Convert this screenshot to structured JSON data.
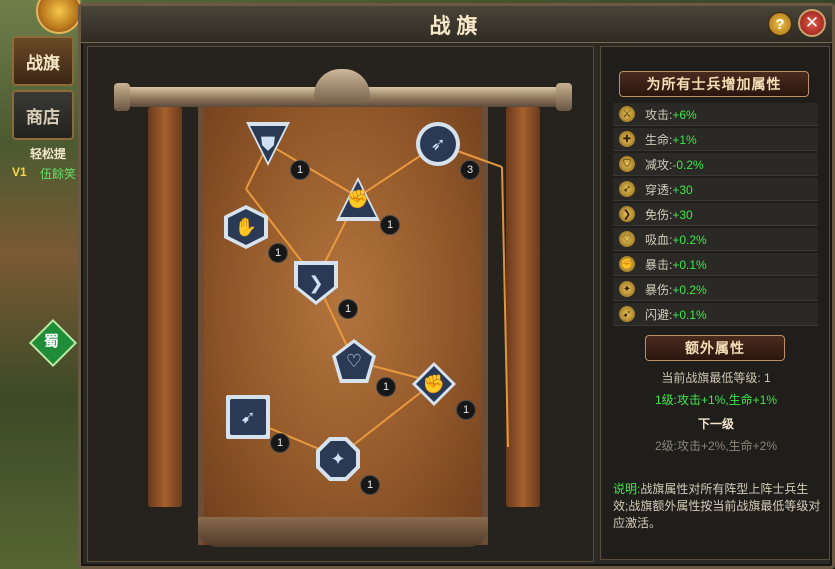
{
  "window": {
    "title": "战旗"
  },
  "sidebar": {
    "tabs": [
      {
        "label": "战旗"
      },
      {
        "label": "商店"
      }
    ]
  },
  "background": {
    "text1": "轻松提",
    "text2": "伍餘笑",
    "text3": "V1",
    "faction": "蜀"
  },
  "flag_nodes": [
    {
      "id": "attack",
      "icon": "triangle-crest-icon",
      "level": "1"
    },
    {
      "id": "pierce-circle",
      "icon": "spear-icon",
      "level": "3"
    },
    {
      "id": "strength",
      "icon": "muscle-icon",
      "level": "1"
    },
    {
      "id": "shield-arm",
      "icon": "arm-icon",
      "level": "1"
    },
    {
      "id": "reduce-dmg",
      "icon": "wing-icon",
      "level": "1"
    },
    {
      "id": "lifesteal",
      "icon": "heart-icon",
      "level": "1"
    },
    {
      "id": "crit",
      "icon": "fist-icon",
      "level": "1"
    },
    {
      "id": "dodge",
      "icon": "running-icon",
      "level": "1"
    },
    {
      "id": "crit-dmg",
      "icon": "claw-icon",
      "level": "1"
    }
  ],
  "attributes": {
    "header": "为所有士兵增加属性",
    "items": [
      {
        "label": "攻击:",
        "value": "+6%",
        "icon": "attack-icon"
      },
      {
        "label": "生命:",
        "value": "+1%",
        "icon": "life-icon"
      },
      {
        "label": "减攻:",
        "value": "-0.2%",
        "icon": "reduce-icon"
      },
      {
        "label": "穿透:",
        "value": "+30",
        "icon": "pierce-icon"
      },
      {
        "label": "免伤:",
        "value": "+30",
        "icon": "immune-icon"
      },
      {
        "label": "吸血:",
        "value": "+0.2%",
        "icon": "lifesteal-icon"
      },
      {
        "label": "暴击:",
        "value": "+0.1%",
        "icon": "crit-icon"
      },
      {
        "label": "暴伤:",
        "value": "+0.2%",
        "icon": "critdmg-icon"
      },
      {
        "label": "闪避:",
        "value": "+0.1%",
        "icon": "dodge-icon"
      }
    ]
  },
  "extra": {
    "header": "额外属性",
    "current_level_label": "当前战旗最低等级:",
    "current_level_value": "1",
    "current_bonus": "1级:攻击+1%,生命+1%",
    "next_header": "下一级",
    "next_bonus": "2级:攻击+2%,生命+2%"
  },
  "description": {
    "label": "说明:",
    "text": "战旗属性对所有阵型上阵士兵生效;战旗额外属性按当前战旗最低等级对应激活。"
  },
  "colors": {
    "green": "#3ee64a",
    "frame_blue": "#d6e2ee"
  }
}
